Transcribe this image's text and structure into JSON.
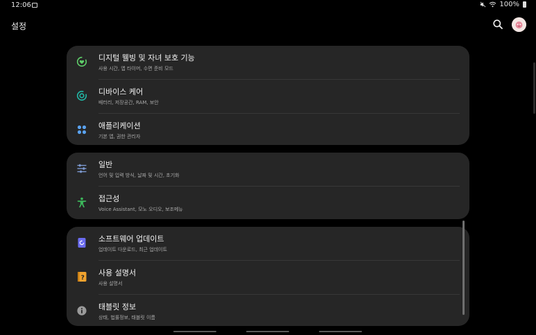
{
  "status_bar": {
    "time": "12:06",
    "battery": "100%"
  },
  "app_bar": {
    "title": "설정"
  },
  "cards": [
    {
      "items": [
        {
          "title": "디지털 웰빙 및 자녀 보호 기능",
          "subtitle": "사용 시간, 앱 타이머, 수면 준비 모드",
          "icon": "digital-wellbeing-icon",
          "color": "#5fcf6a"
        },
        {
          "title": "디바이스 케어",
          "subtitle": "배터리, 저장공간, RAM, 보안",
          "icon": "device-care-icon",
          "color": "#21b8a6"
        },
        {
          "title": "애플리케이션",
          "subtitle": "기본 앱, 권한 관리자",
          "icon": "apps-grid-icon",
          "color": "#5aa2f0"
        }
      ]
    },
    {
      "items": [
        {
          "title": "일반",
          "subtitle": "언어 및 입력 방식, 날짜 및 시간, 초기화",
          "icon": "sliders-icon",
          "color": "#7d9ad1"
        },
        {
          "title": "접근성",
          "subtitle": "Voice Assistant, 모노 오디오, 보조메뉴",
          "icon": "accessibility-icon",
          "color": "#3cb55a"
        }
      ]
    },
    {
      "items": [
        {
          "title": "소프트웨어 업데이트",
          "subtitle": "업데이트 다운로드, 최근 업데이트",
          "icon": "software-update-icon",
          "color": "#6b6cf0"
        },
        {
          "title": "사용 설명서",
          "subtitle": "사용 설명서",
          "icon": "user-manual-icon",
          "color": "#f0a22e"
        },
        {
          "title": "태블릿 정보",
          "subtitle": "상태, 법률정보, 태블릿 이름",
          "icon": "info-icon",
          "color": "#9a9a9a"
        }
      ]
    }
  ]
}
